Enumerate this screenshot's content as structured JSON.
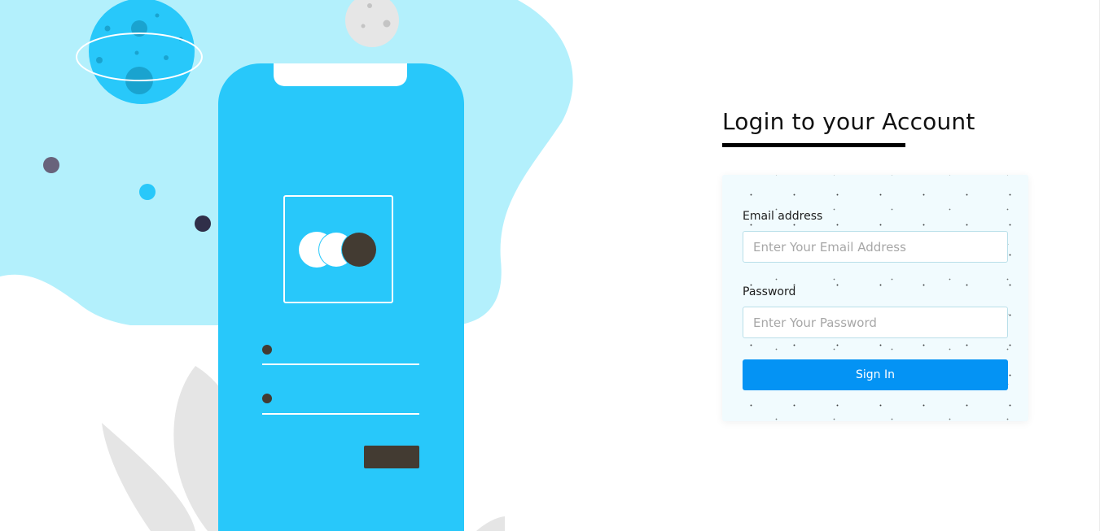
{
  "login": {
    "title": "Login to your Account",
    "email_label": "Email address",
    "email_placeholder": "Enter Your Email Address",
    "email_value": "",
    "password_label": "Password",
    "password_placeholder": "Enter Your Password",
    "password_value": "",
    "sign_in_label": "Sign In"
  },
  "colors": {
    "accent": "#0493f4",
    "phone": "#28c8fa",
    "blob": "#b3f0fc",
    "dark": "#433b32",
    "underline": "#000000"
  },
  "illustration": {
    "icons": [
      "planet-icon",
      "moon-icon",
      "smartphone-icon",
      "logo-circles-icon",
      "leaf-icon"
    ]
  }
}
